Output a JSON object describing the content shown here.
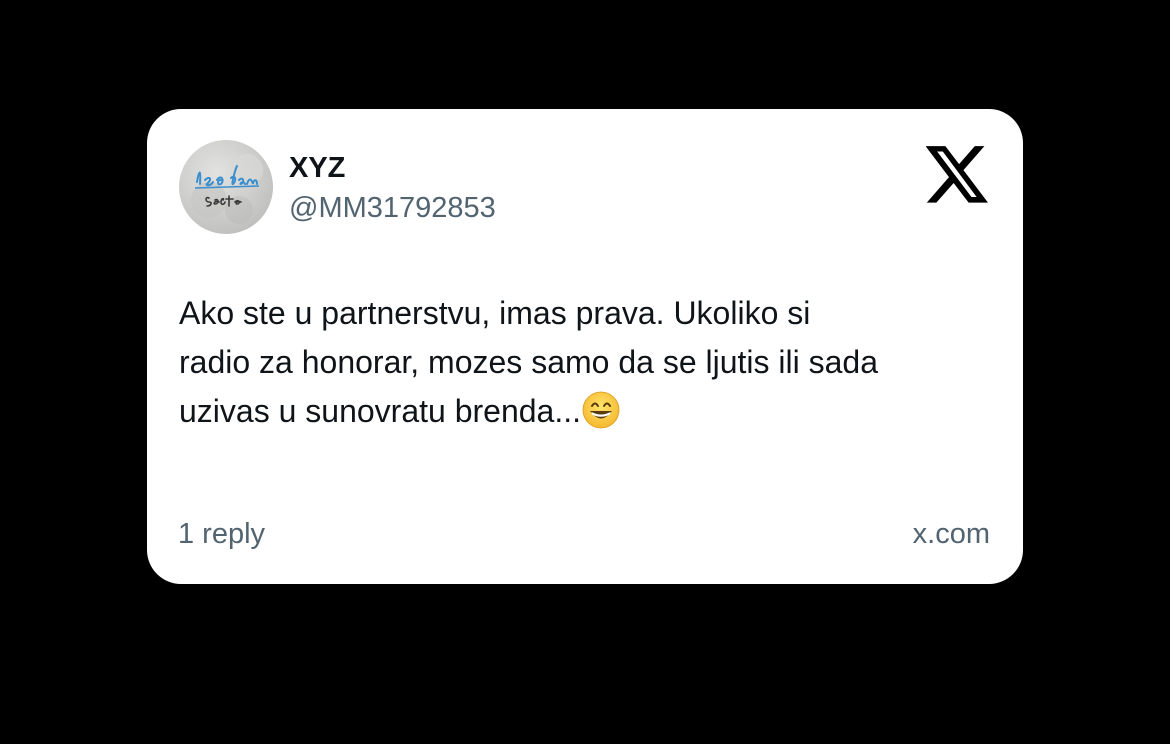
{
  "post": {
    "author_name": "XYZ",
    "author_handle": "@MM31792853",
    "avatar_text": "leo dan\nsecte",
    "text_lines": [
      "Ako ste u partnerstvu, imas prava. Ukoliko si",
      "radio za honorar, mozes samo da se ljutis ili sada",
      "uzivas u sunovratu brenda..."
    ],
    "emoji": "grinning-face-with-smiling-eyes",
    "reply_count": "1 reply",
    "source": "x.com",
    "platform_logo": "x-logo-icon"
  },
  "colors": {
    "background": "#000000",
    "card": "#ffffff",
    "primary_text": "#0f1419",
    "secondary_text": "#536471"
  }
}
